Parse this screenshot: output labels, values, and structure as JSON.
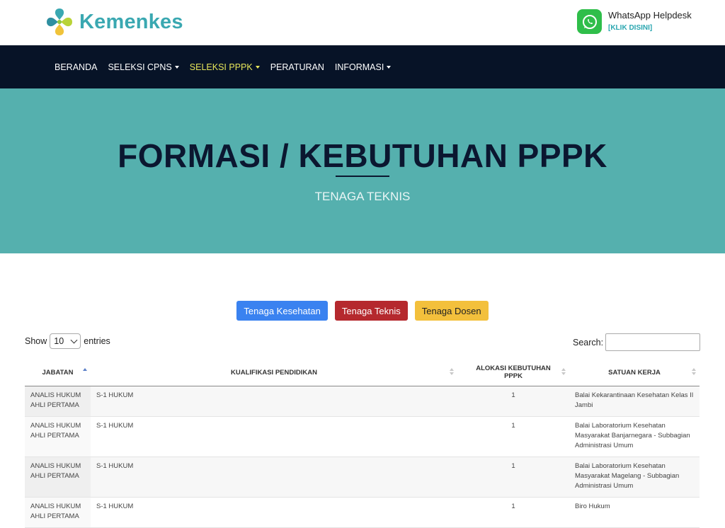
{
  "header": {
    "logo_text": "Kemenkes",
    "helpdesk_title": "WhatsApp Helpdesk",
    "helpdesk_link": "[KLIK DISINI]"
  },
  "nav": {
    "items": [
      {
        "label": "BERANDA",
        "dropdown": false
      },
      {
        "label": "SELEKSI CPNS",
        "dropdown": true
      },
      {
        "label": "SELEKSI PPPK",
        "dropdown": true,
        "active": true
      },
      {
        "label": "PERATURAN",
        "dropdown": false
      },
      {
        "label": "INFORMASI",
        "dropdown": true
      }
    ]
  },
  "hero": {
    "title": "FORMASI / KEBUTUHAN PPPK",
    "subtitle": "TENAGA TEKNIS"
  },
  "tabs": {
    "kesehatan": "Tenaga Kesehatan",
    "teknis": "Tenaga Teknis",
    "dosen": "Tenaga Dosen"
  },
  "controls": {
    "show_label": "Show",
    "entries_value": "10",
    "entries_label": "entries",
    "search_label": "Search:"
  },
  "table": {
    "headers": [
      "JABATAN",
      "KUALIFIKASI PENDIDIKAN",
      "ALOKASI KEBUTUHAN PPPK",
      "SATUAN KERJA"
    ],
    "rows": [
      [
        "ANALIS HUKUM AHLI PERTAMA",
        "S-1 HUKUM",
        "1",
        "Balai Kekarantinaan Kesehatan Kelas II Jambi"
      ],
      [
        "ANALIS HUKUM AHLI PERTAMA",
        "S-1 HUKUM",
        "1",
        "Balai Laboratorium Kesehatan Masyarakat Banjarnegara - Subbagian Administrasi Umum"
      ],
      [
        "ANALIS HUKUM AHLI PERTAMA",
        "S-1 HUKUM",
        "1",
        "Balai Laboratorium Kesehatan Masyarakat Magelang - Subbagian Administrasi Umum"
      ],
      [
        "ANALIS HUKUM AHLI PERTAMA",
        "S-1 HUKUM",
        "1",
        "Biro Hukum"
      ]
    ]
  },
  "colors": {
    "nav_bg": "#071327",
    "hero_bg": "#55b0ae",
    "brand": "#3aa8b1",
    "active_nav": "#e7e65a",
    "btn_blue": "#3a82f0",
    "btn_red": "#b5292e",
    "btn_yellow": "#f3c03c"
  }
}
